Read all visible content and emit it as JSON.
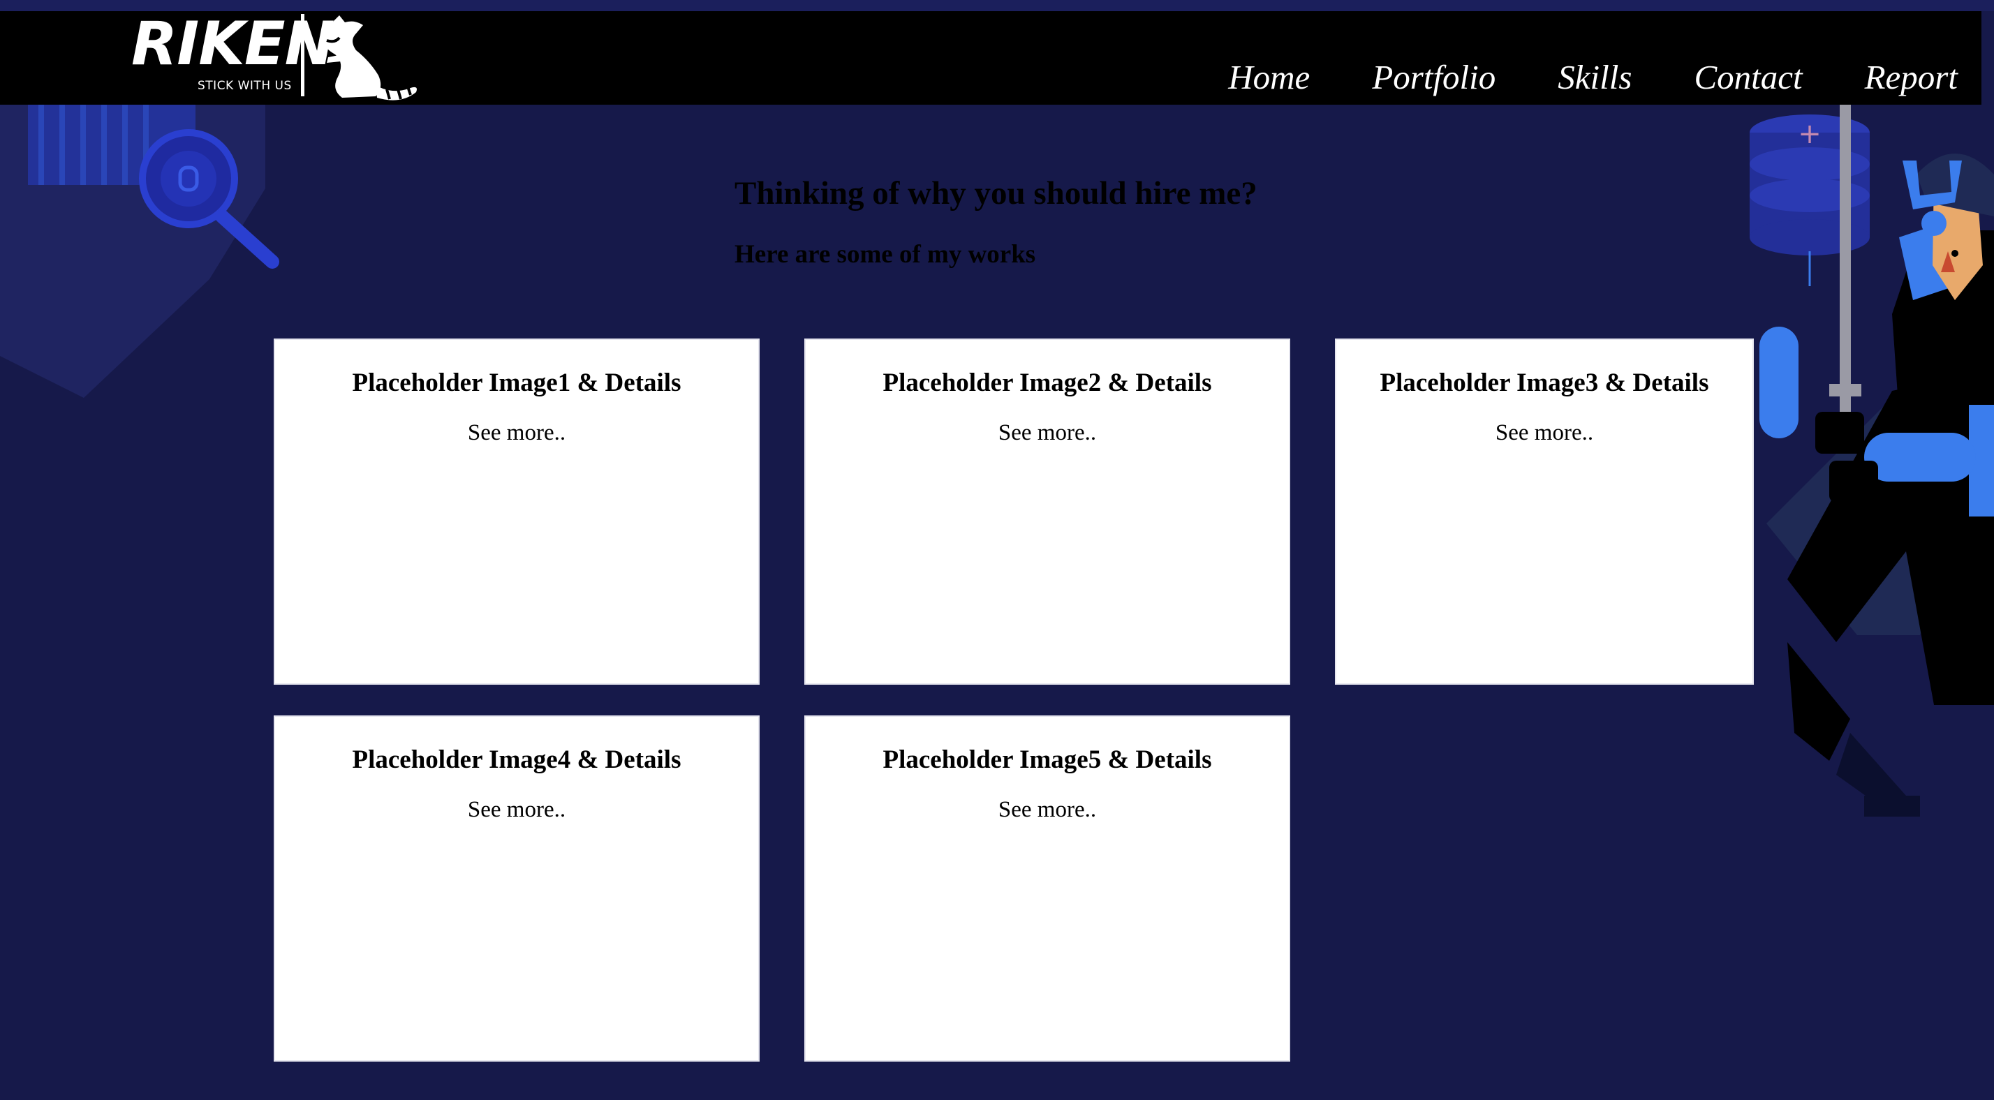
{
  "brand": {
    "name": "RIKEN",
    "tagline": "STICK WITH US"
  },
  "nav": {
    "items": [
      {
        "label": "Home"
      },
      {
        "label": "Portfolio"
      },
      {
        "label": "Skills"
      },
      {
        "label": "Contact"
      },
      {
        "label": "Report"
      }
    ]
  },
  "main": {
    "heading": "Thinking of why you should hire me?",
    "subheading": "Here are some of my works"
  },
  "cards": [
    {
      "title": "Placeholder Image1 & Details",
      "link": "See more.."
    },
    {
      "title": "Placeholder Image2 & Details",
      "link": "See more.."
    },
    {
      "title": "Placeholder Image3 & Details",
      "link": "See more.."
    },
    {
      "title": "Placeholder Image4 & Details",
      "link": "See more.."
    },
    {
      "title": "Placeholder Image5 & Details",
      "link": "See more.."
    }
  ],
  "colors": {
    "background": "#16194a",
    "navbar": "#000000",
    "accent_blue": "#3b7ded",
    "card": "#ffffff"
  },
  "icons": {
    "raccoon": "raccoon-icon",
    "magnifier": "magnifier-bug-icon",
    "database": "database-icon",
    "samurai": "samurai-illustration"
  }
}
